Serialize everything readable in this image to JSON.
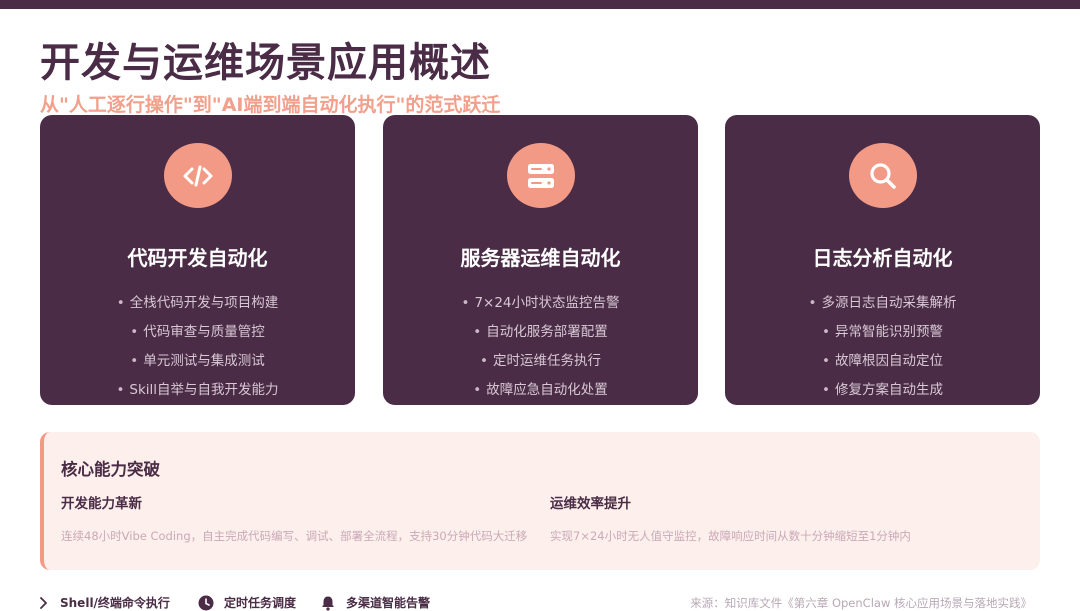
{
  "header": {
    "title": "开发与运维场景应用概述",
    "subtitle": "从\"人工逐行操作\"到\"AI端到端自动化执行\"的范式跃迁"
  },
  "cards": [
    {
      "icon": "code-icon",
      "title": "代码开发自动化",
      "items": [
        "全栈代码开发与项目构建",
        "代码审查与质量管控",
        "单元测试与集成测试",
        "Skill自举与自我开发能力"
      ]
    },
    {
      "icon": "server-icon",
      "title": "服务器运维自动化",
      "items": [
        "7×24小时状态监控告警",
        "自动化服务部署配置",
        "定时运维任务执行",
        "故障应急自动化处置"
      ]
    },
    {
      "icon": "search-icon",
      "title": "日志分析自动化",
      "items": [
        "多源日志自动采集解析",
        "异常智能识别预警",
        "故障根因自动定位",
        "修复方案自动生成"
      ]
    }
  ],
  "panel": {
    "title": "核心能力突破",
    "columns": [
      {
        "heading": "开发能力革新",
        "desc": "连续48小时Vibe Coding，自主完成代码编写、调试、部署全流程，支持30分钟代码大迁移"
      },
      {
        "heading": "运维效率提升",
        "desc": "实现7×24小时无人值守监控，故障响应时间从数十分钟缩短至1分钟内"
      }
    ]
  },
  "footer": {
    "items": [
      {
        "icon": "terminal-chevron-icon",
        "label": "Shell/终端命令执行"
      },
      {
        "icon": "clock-icon",
        "label": "定时任务调度"
      },
      {
        "icon": "bell-icon",
        "label": "多渠道智能告警"
      }
    ],
    "source": "来源：知识库文件《第六章 OpenClaw 核心应用场景与落地实践》"
  },
  "colors": {
    "primary": "#4a2c46",
    "accent": "#f39a86",
    "panel_bg": "#fdf0ec"
  }
}
